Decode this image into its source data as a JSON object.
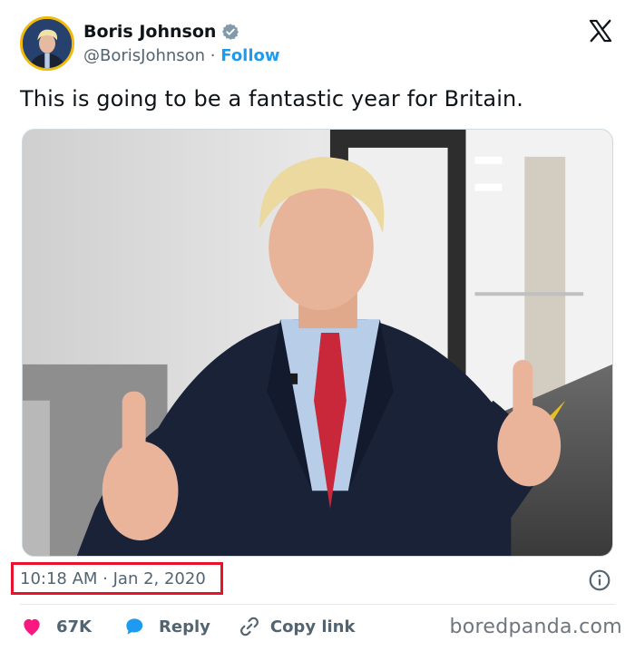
{
  "header": {
    "display_name": "Boris Johnson",
    "handle": "@BorisJohnson",
    "separator": " · ",
    "follow_label": "Follow",
    "icons": {
      "verified": "verified-badge-icon",
      "logo": "x-logo-icon"
    }
  },
  "tweet": {
    "text": "This is going to be a fantastic year for Britain."
  },
  "meta": {
    "timestamp": "10:18 AM · Jan 2, 2020",
    "highlight_color": "#e8122c",
    "info_icon": "info-icon"
  },
  "actions": {
    "like_count": "67K",
    "reply_label": "Reply",
    "copy_label": "Copy link",
    "icons": {
      "like": "heart-icon",
      "reply": "speech-bubble-icon",
      "copy": "link-icon"
    },
    "colors": {
      "heart": "#f91880",
      "reply": "#1d9bf0"
    }
  },
  "watermark": "boredpanda.com"
}
